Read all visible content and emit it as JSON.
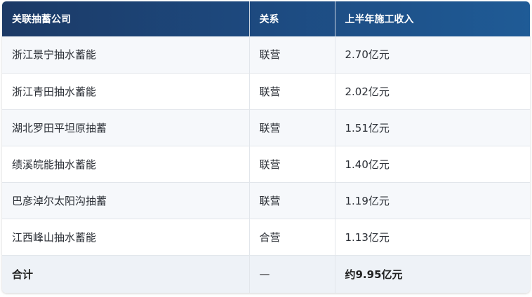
{
  "table": {
    "headers": [
      "关联抽蓄公司",
      "关系",
      "上半年施工收入"
    ],
    "rows": [
      {
        "company": "浙江景宁抽水蓄能",
        "relation": "联营",
        "revenue": "2.70亿元"
      },
      {
        "company": "浙江青田抽水蓄能",
        "relation": "联营",
        "revenue": "2.02亿元"
      },
      {
        "company": "湖北罗田平坦原抽蓄",
        "relation": "联营",
        "revenue": "1.51亿元"
      },
      {
        "company": "绩溪皖能抽水蓄能",
        "relation": "联营",
        "revenue": "1.40亿元"
      },
      {
        "company": "巴彦淖尔太阳沟抽蓄",
        "relation": "联营",
        "revenue": "1.19亿元"
      },
      {
        "company": "江西峰山抽水蓄能",
        "relation": "合营",
        "revenue": "1.13亿元"
      }
    ],
    "total": {
      "label": "合计",
      "relation": "—",
      "revenue": "约9.95亿元"
    }
  }
}
